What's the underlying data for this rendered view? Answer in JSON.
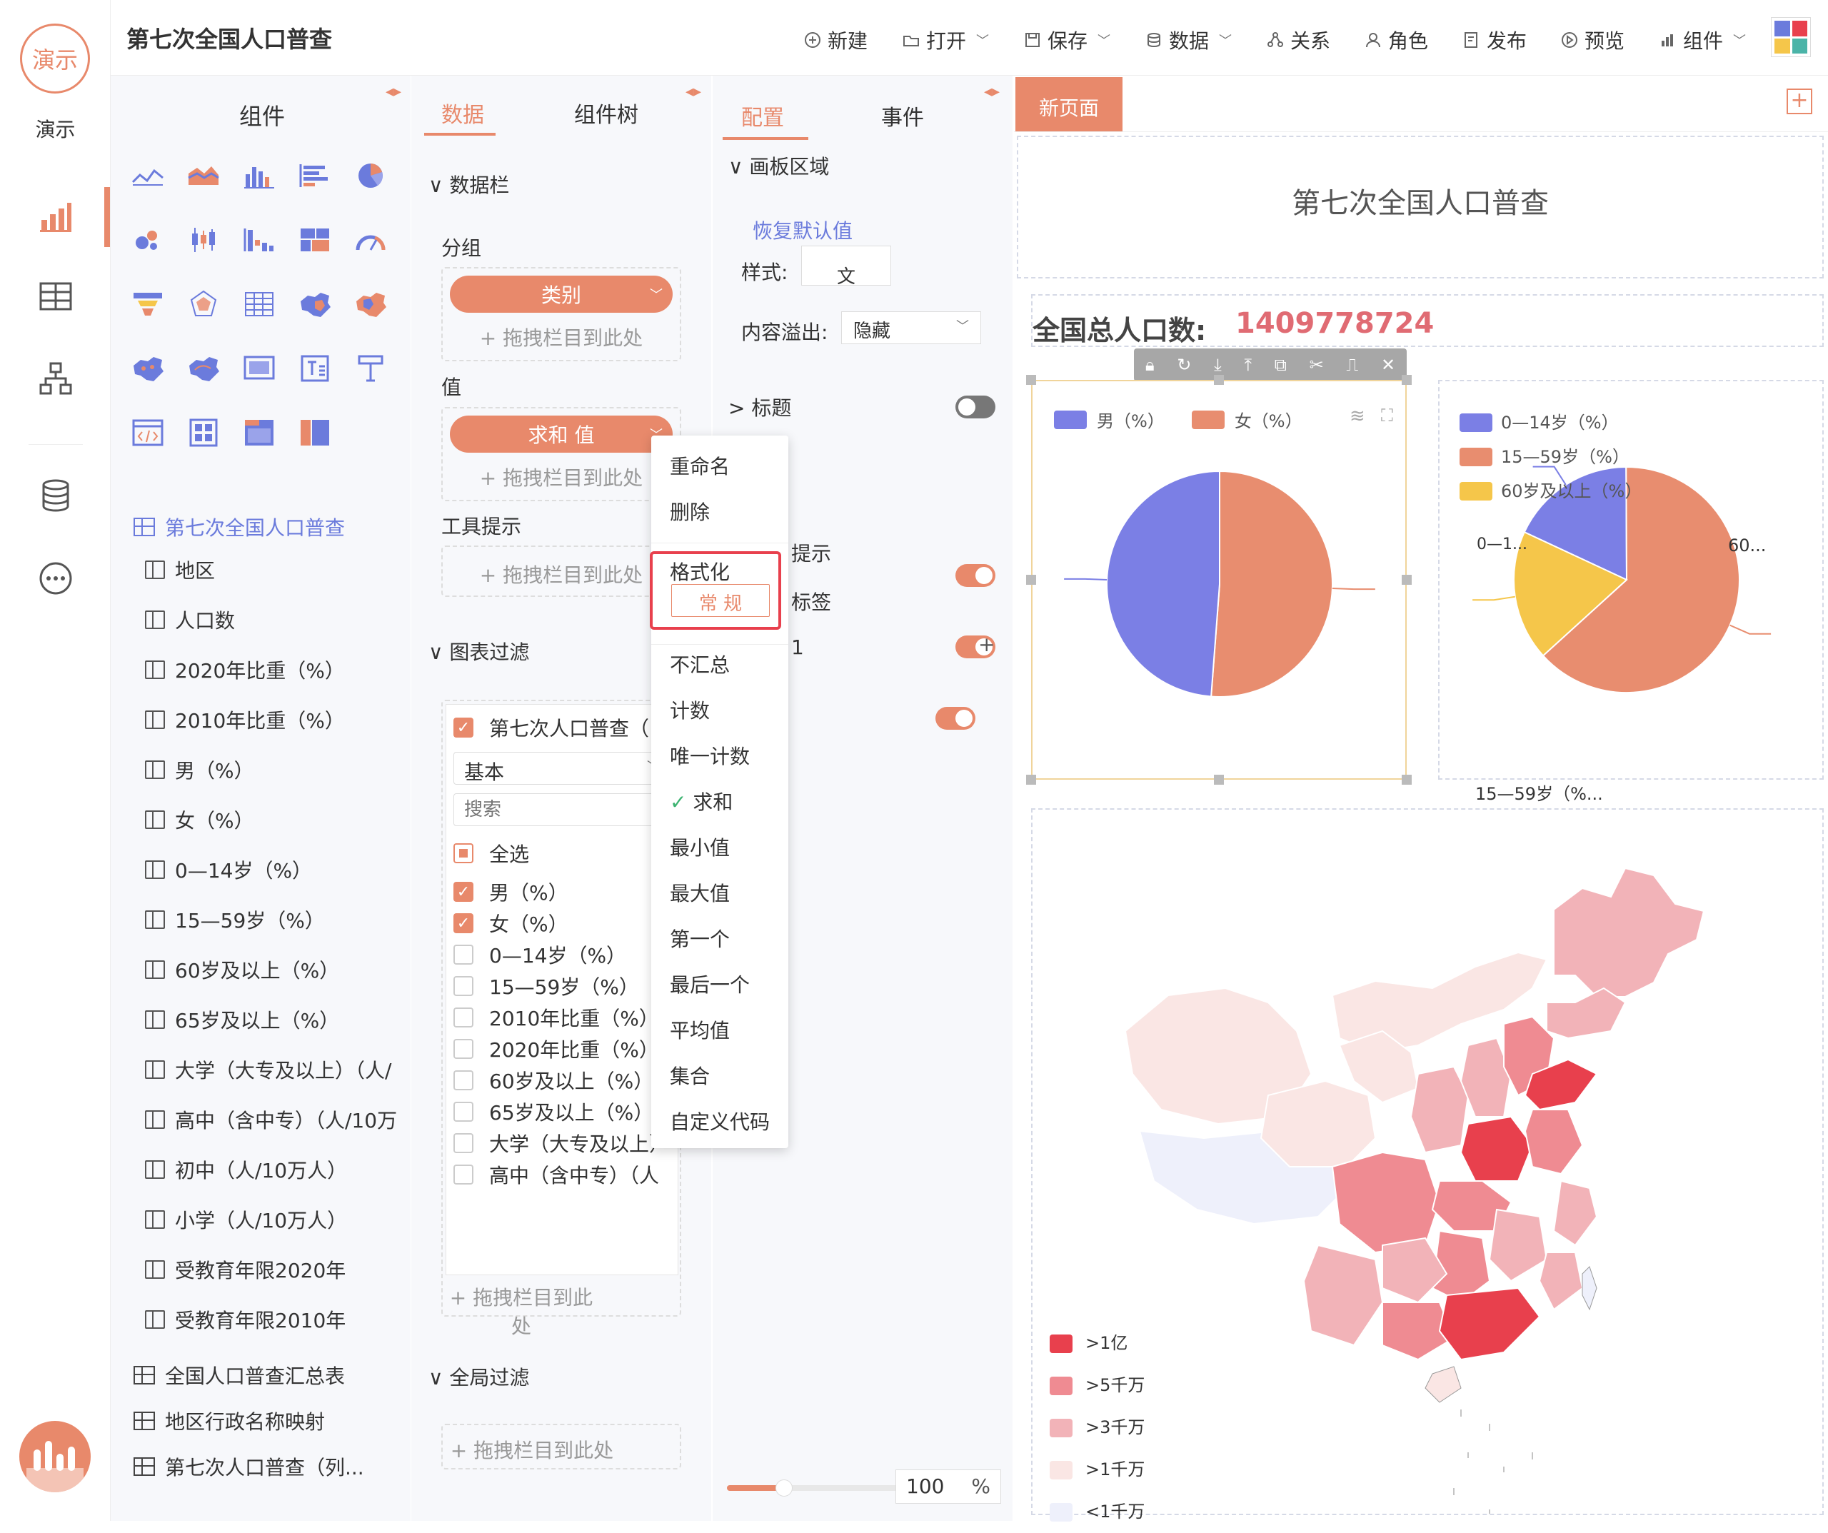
{
  "rail": {
    "logo_text": "演示",
    "label": "演示",
    "icons": [
      "bar-chart-icon",
      "table-icon",
      "hierarchy-icon",
      "database-icon",
      "more-icon"
    ]
  },
  "header": {
    "title": "第七次全国人口普查",
    "toolbar": [
      {
        "label": "新建",
        "icon": "plus-circle-icon",
        "has_dropdown": false
      },
      {
        "label": "打开",
        "icon": "folder-open-icon",
        "has_dropdown": true
      },
      {
        "label": "保存",
        "icon": "save-icon",
        "has_dropdown": true
      },
      {
        "label": "数据",
        "icon": "database-icon",
        "has_dropdown": true
      },
      {
        "label": "关系",
        "icon": "relation-icon",
        "has_dropdown": false
      },
      {
        "label": "角色",
        "icon": "user-icon",
        "has_dropdown": false
      },
      {
        "label": "发布",
        "icon": "publish-icon",
        "has_dropdown": false
      },
      {
        "label": "预览",
        "icon": "preview-icon",
        "has_dropdown": false
      },
      {
        "label": "组件",
        "icon": "chart-icon",
        "has_dropdown": true
      }
    ]
  },
  "components_panel": {
    "title": "组件",
    "dataset_tree": {
      "root": "第七次全国人口普查",
      "fields": [
        "地区",
        "人口数",
        "2020年比重（%）",
        "2010年比重（%）",
        "男（%）",
        "女（%）",
        "0—14岁（%）",
        "15—59岁（%）",
        "60岁及以上（%）",
        "65岁及以上（%）",
        "大学（大专及以上）（人/",
        "高中（含中专）（人/10万",
        "初中（人/10万人）",
        "小学（人/10万人）",
        "受教育年限2020年",
        "受教育年限2010年"
      ],
      "other_tables": [
        "全国人口普查汇总表",
        "地区行政名称映射",
        "第七次人口普查（列..."
      ]
    }
  },
  "data_panel": {
    "tabs": [
      "数据",
      "组件树"
    ],
    "section_data_bar": "数据栏",
    "group_label": "分组",
    "group_pill": "类别",
    "value_label": "值",
    "value_pill": "求和 值",
    "tooltip_label": "工具提示",
    "drop_hint": "拖拽栏目到此处",
    "chart_filter": "图表过滤",
    "filter_title": "第七次人口普查（",
    "filter_select": "基本",
    "filter_search_placeholder": "搜索",
    "select_all": "全选",
    "filter_items": [
      {
        "label": "男（%）",
        "checked": true
      },
      {
        "label": "女（%）",
        "checked": true
      },
      {
        "label": "0—14岁（%）",
        "checked": false
      },
      {
        "label": "15—59岁（%）",
        "checked": false
      },
      {
        "label": "2010年比重（%）",
        "checked": false
      },
      {
        "label": "2020年比重（%）",
        "checked": false
      },
      {
        "label": "60岁及以上（%）",
        "checked": false
      },
      {
        "label": "65岁及以上（%）",
        "checked": false
      },
      {
        "label": "大学（大专及以上）",
        "checked": false
      },
      {
        "label": "高中（含中专）（人",
        "checked": false
      }
    ],
    "global_filter": "全局过滤"
  },
  "context_menu": {
    "items": [
      "重命名",
      "删除",
      "格式化",
      "不汇总",
      "计数",
      "唯一计数",
      "求和",
      "最小值",
      "最大值",
      "第一个",
      "最后一个",
      "平均值",
      "集合",
      "自定义代码"
    ],
    "format_option": "常 规",
    "checked_item": "求和"
  },
  "config_panel": {
    "tabs": [
      "配置",
      "事件"
    ],
    "canvas_section": "画板区域",
    "restore_default": "恢复默认值",
    "style_label": "样式:",
    "style_value": "文",
    "overflow_label": "内容溢出:",
    "overflow_value": "隐藏",
    "title_section": "标题",
    "tooltip_row": "提示",
    "label_row": "标签",
    "row3": "1",
    "zoom_value": "100",
    "zoom_unit": "%"
  },
  "canvas": {
    "page_tab": "新页面",
    "report_title": "第七次全国人口普查",
    "total_label": "全国总人口数:",
    "total_value": "1409778724",
    "pie1_legend": [
      "男（%）",
      "女（%）"
    ],
    "pie2_legend": [
      "0—14岁（%）",
      "15—59岁（%）",
      "60岁及以上（%）"
    ],
    "pie2_labels": [
      "60...",
      "0—1...",
      "15—59岁（%..."
    ],
    "map_legend": [
      ">1亿",
      ">5千万",
      ">3千万",
      ">1千万",
      "<1千万"
    ],
    "colors": {
      "accent": "#e8896b",
      "male": "#7b7fe5",
      "female": "#e88d6f",
      "age60": "#f5c64a",
      "map_1": "#e8404d",
      "map_2": "#ef8b92",
      "map_3": "#f2b3b8",
      "map_4": "#fae6e4",
      "map_5": "#eef0fb"
    }
  },
  "chart_data": [
    {
      "type": "pie",
      "categories": [
        "男（%）",
        "女（%）"
      ],
      "values": [
        51.2,
        48.8
      ]
    },
    {
      "type": "pie",
      "categories": [
        "0—14岁（%）",
        "15—59岁（%）",
        "60岁及以上（%）"
      ],
      "values": [
        18.0,
        63.4,
        18.7
      ]
    }
  ]
}
